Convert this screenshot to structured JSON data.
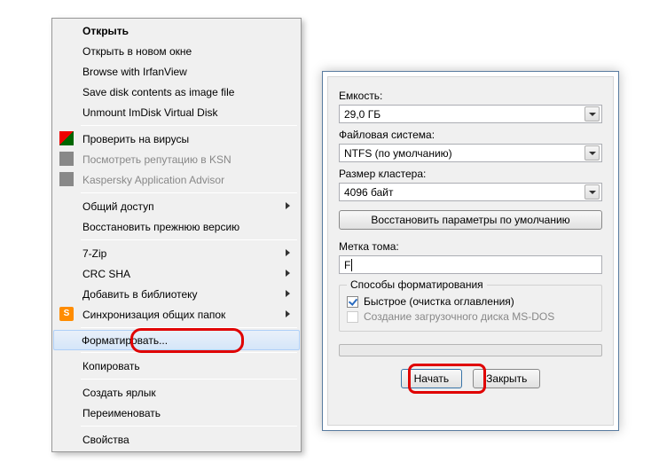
{
  "menu": {
    "open": "Открыть",
    "open_new": "Открыть в новом окне",
    "irfan": "Browse with IrfanView",
    "save_img": "Save disk contents as image file",
    "unmount": "Unmount ImDisk Virtual Disk",
    "scan": "Проверить на вирусы",
    "ksn": "Посмотреть репутацию в KSN",
    "kaa": "Kaspersky Application Advisor",
    "share": "Общий доступ",
    "restore": "Восстановить прежнюю версию",
    "sevenzip": "7-Zip",
    "crcsha": "CRC SHA",
    "addlib": "Добавить в библиотеку",
    "sync": "Синхронизация общих папок",
    "format": "Форматировать...",
    "copy": "Копировать",
    "shortcut": "Создать ярлык",
    "rename": "Переименовать",
    "props": "Свойства",
    "icon_s": "S"
  },
  "dlg": {
    "capacity_label": "Емкость:",
    "capacity_value": "29,0 ГБ",
    "fs_label": "Файловая система:",
    "fs_value": "NTFS (по умолчанию)",
    "cluster_label": "Размер кластера:",
    "cluster_value": "4096 байт",
    "restore_defaults": "Восстановить параметры по умолчанию",
    "volume_label": "Метка тома:",
    "volume_value": "F",
    "methods_title": "Способы форматирования",
    "quick": "Быстрое (очистка оглавления)",
    "msdos": "Создание загрузочного диска MS-DOS",
    "start": "Начать",
    "close": "Закрыть"
  }
}
